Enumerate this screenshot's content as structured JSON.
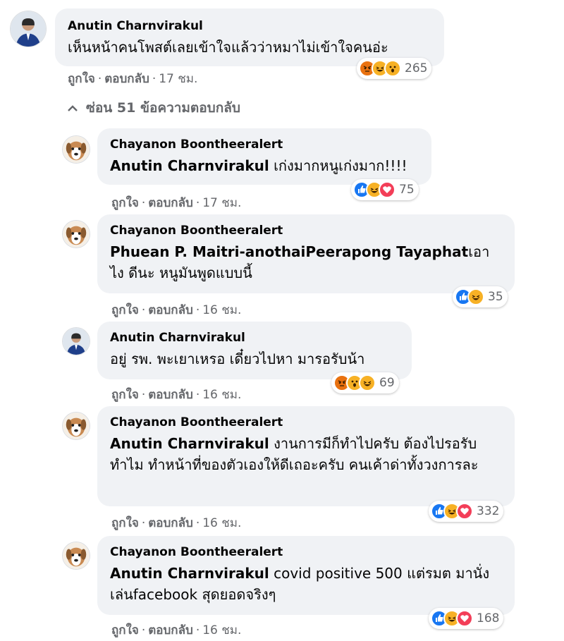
{
  "labels": {
    "like": "ถูกใจ",
    "reply": "ตอบกลับ",
    "dot": "·"
  },
  "hide_replies": "ซ่อน 51 ข้อความตอบกลับ",
  "comments": [
    {
      "author": "Anutin Charnvirakul",
      "mention": "",
      "text": "เห็นหน้าคนโพสต์เลยเข้าใจแล้วว่าหมาไม่เข้าใจคนอ่ะ",
      "time": "17 ชม.",
      "reactions": [
        "angry",
        "haha",
        "wow"
      ],
      "count": "265"
    },
    {
      "author": "Chayanon Boontheeralert",
      "mention": "Anutin Charnvirakul",
      "text": " เก่งมากหนูเก่งมาก!!!!",
      "time": "17 ชม.",
      "reactions": [
        "like",
        "haha",
        "love"
      ],
      "count": "75"
    },
    {
      "author": "Chayanon Boontheeralert",
      "mention": "Phuean P. Maitri-anothaiPeerapong Tayaphat",
      "text": "เอาไง ดีนะ หนูมันพูดแบบนี้",
      "time": "16 ชม.",
      "reactions": [
        "like",
        "haha"
      ],
      "count": "35"
    },
    {
      "author": "Anutin Charnvirakul",
      "mention": "",
      "text": "อยู่ รพ. พะเยาเหรอ เดี๋ยวไปหา มารอรับน้า",
      "time": "16 ชม.",
      "reactions": [
        "angry",
        "wow",
        "haha"
      ],
      "count": "69"
    },
    {
      "author": "Chayanon Boontheeralert",
      "mention": "Anutin Charnvirakul",
      "text": " งานการมีก็ทำไปครับ ต้องไปรอรับทำไม ทำหน้าที่ของตัวเองให้ดีเถอะครับ คนเค้าด่าทั้งวงการละ",
      "time": "16 ชม.",
      "reactions": [
        "like",
        "haha",
        "love"
      ],
      "count": "332"
    },
    {
      "author": "Chayanon Boontheeralert",
      "mention": "Anutin Charnvirakul",
      "text": " covid positive 500 แต่รมต มานั่งเล่นfacebook สุดยอดจริงๆ",
      "time": "16 ชม.",
      "reactions": [
        "like",
        "haha",
        "love"
      ],
      "count": "168"
    }
  ]
}
